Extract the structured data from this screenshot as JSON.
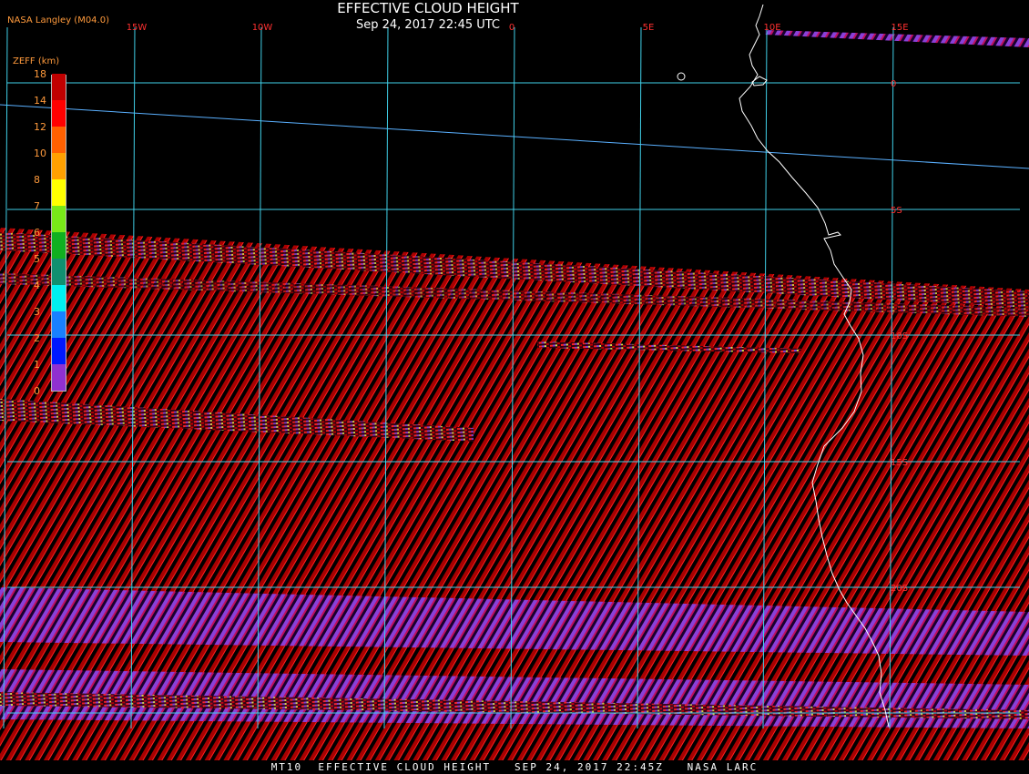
{
  "header": {
    "title": "EFFECTIVE CLOUD HEIGHT",
    "subtitle": "Sep 24, 2017 22:45 UTC",
    "provider": "NASA Langley (M04.0)"
  },
  "legend": {
    "title": "ZEFF (km)",
    "ticks": [
      "0",
      "1",
      "2",
      "3",
      "4",
      "5",
      "6",
      "7",
      "8",
      "10",
      "12",
      "14",
      "18"
    ],
    "colors": [
      "#9030d0",
      "#0018ff",
      "#1880ff",
      "#00f0f0",
      "#109070",
      "#10b020",
      "#78e818",
      "#ffff00",
      "#ffa000",
      "#ff6000",
      "#ff0000",
      "#c00000",
      "#700010"
    ]
  },
  "map": {
    "lon_labels": [
      "15W",
      "10W",
      "0",
      "5E",
      "10E",
      "15E"
    ],
    "lat_labels": [
      "0",
      "5S",
      "10S",
      "15S",
      "20S"
    ],
    "colors": {
      "background": "#000000",
      "grid": "#40d0e8",
      "coast": "#ffffff",
      "label": "#ff3030",
      "stripe_red": "#b00000",
      "stripe_purple": "#7030c0"
    }
  },
  "footer": {
    "text": "MT10  EFFECTIVE CLOUD HEIGHT   SEP 24, 2017 22:45Z   NASA LARC"
  }
}
